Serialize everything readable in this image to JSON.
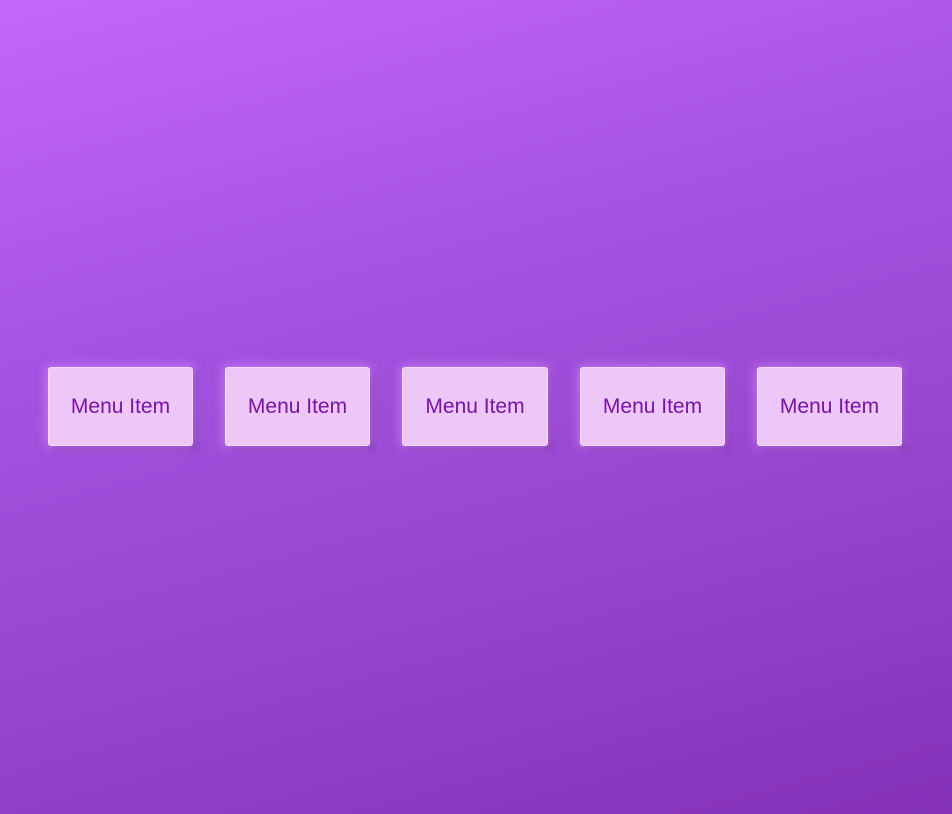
{
  "menu": {
    "items": [
      {
        "label": "Menu Item"
      },
      {
        "label": "Menu Item"
      },
      {
        "label": "Menu Item"
      },
      {
        "label": "Menu Item"
      },
      {
        "label": "Menu Item"
      }
    ]
  },
  "colors": {
    "background_top": "#c466fb",
    "background_bottom": "#8431b8",
    "item_background": "#ecc7f7",
    "item_text": "#7a12a8"
  }
}
